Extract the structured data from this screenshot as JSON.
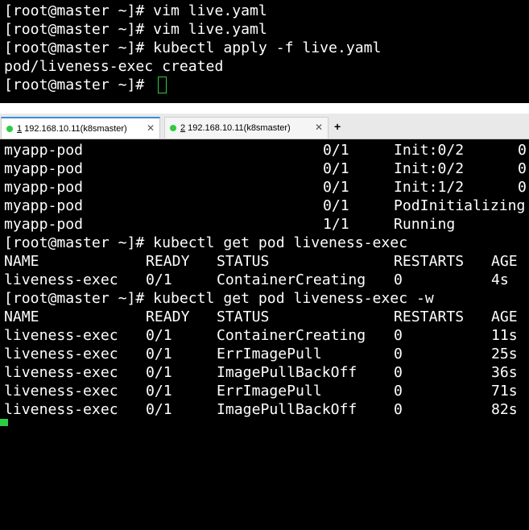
{
  "colors": {
    "terminal_bg": "#000000",
    "terminal_fg": "#ffffff",
    "cursor": "#2ecc40",
    "status_dot": "#2ecc40",
    "tab_accent": "#3c8cd8"
  },
  "pane_top": {
    "lines": [
      "[root@master ~]# vim live.yaml",
      "[root@master ~]# vim live.yaml",
      "[root@master ~]# kubectl apply -f live.yaml",
      "pod/liveness-exec created",
      "[root@master ~]# "
    ]
  },
  "tabs": [
    {
      "num": "1",
      "host": "192.168.10.11(k8smaster)",
      "close": "✕",
      "icon": "status-dot"
    },
    {
      "num": "2",
      "host": "192.168.10.11(k8smaster)",
      "close": "✕",
      "icon": "status-dot"
    }
  ],
  "new_tab_label": "+",
  "pane_bottom": {
    "pod_rows": [
      {
        "name": "myapp-pod",
        "ready": "0/1",
        "status": "Init:0/2",
        "restarts": "0"
      },
      {
        "name": "myapp-pod",
        "ready": "0/1",
        "status": "Init:0/2",
        "restarts": "0"
      },
      {
        "name": "myapp-pod",
        "ready": "0/1",
        "status": "Init:1/2",
        "restarts": "0"
      },
      {
        "name": "myapp-pod",
        "ready": "0/1",
        "status": "PodInitializing",
        "restarts": ""
      },
      {
        "name": "myapp-pod",
        "ready": "1/1",
        "status": "Running",
        "restarts": ""
      }
    ],
    "cmd1": "[root@master ~]# kubectl get pod liveness-exec",
    "headers": {
      "name": "NAME",
      "ready": "READY",
      "status": "STATUS",
      "restarts": "RESTARTS",
      "age": "AGE"
    },
    "result1": [
      {
        "name": "liveness-exec",
        "ready": "0/1",
        "status": "ContainerCreating",
        "restarts": "0",
        "age": "4s"
      }
    ],
    "cmd2": "[root@master ~]# kubectl get pod liveness-exec -w",
    "result2": [
      {
        "name": "liveness-exec",
        "ready": "0/1",
        "status": "ContainerCreating",
        "restarts": "0",
        "age": "11s"
      },
      {
        "name": "liveness-exec",
        "ready": "0/1",
        "status": "ErrImagePull",
        "restarts": "0",
        "age": "25s"
      },
      {
        "name": "liveness-exec",
        "ready": "0/1",
        "status": "ImagePullBackOff",
        "restarts": "0",
        "age": "36s"
      },
      {
        "name": "liveness-exec",
        "ready": "0/1",
        "status": "ErrImagePull",
        "restarts": "0",
        "age": "71s"
      },
      {
        "name": "liveness-exec",
        "ready": "0/1",
        "status": "ImagePullBackOff",
        "restarts": "0",
        "age": "82s"
      }
    ]
  }
}
